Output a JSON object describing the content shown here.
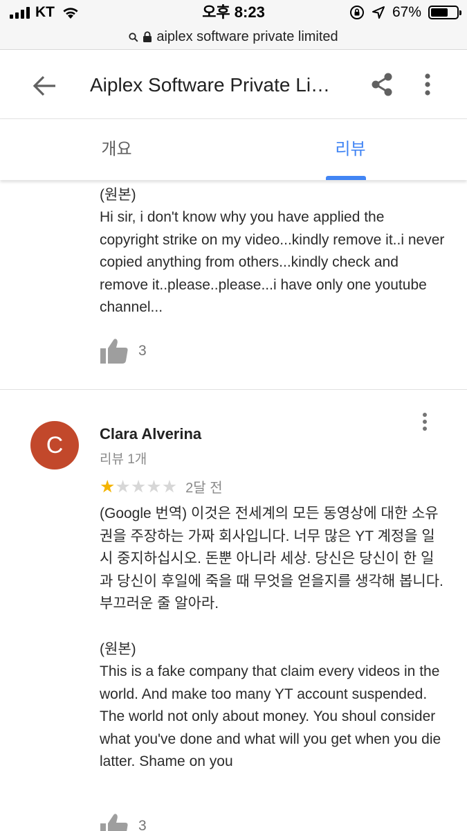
{
  "status_bar": {
    "carrier": "KT",
    "time": "오후 8:23",
    "battery_percent": "67%",
    "battery_level": 0.67
  },
  "url_bar": {
    "text": "aiplex software private limited",
    "icons": [
      "search-icon",
      "lock-icon"
    ]
  },
  "header": {
    "title": "Aiplex Software Private Limited",
    "icons": [
      "back-arrow-icon",
      "share-icon",
      "more-vert-icon"
    ]
  },
  "tabs": [
    {
      "label": "개요",
      "active": false
    },
    {
      "label": "리뷰",
      "active": true
    }
  ],
  "colors": {
    "accent": "#4285f4",
    "avatar_bg": "#c2482b",
    "star_on": "#f4b400",
    "star_off": "#d7d7d7"
  },
  "reviews": [
    {
      "original_label": "(원본)",
      "original_text": "Hi sir, i don't know why you have applied the copyright strike on my video...kindly remove it..i never copied anything from others...kindly check and remove it..please..please...i have only one youtube channel...",
      "likes": "3"
    },
    {
      "avatar_letter": "C",
      "name": "Clara Alverina",
      "review_count": "리뷰 1개",
      "rating": 1,
      "max_rating": 5,
      "date": "2달 전",
      "translated_text": "(Google 번역) 이것은 전세계의 모든 동영상에 대한 소유권을 주장하는 가짜 회사입니다. 너무 많은 YT 계정을 일시 중지하십시오. 돈뿐 아니라 세상. 당신은 당신이 한 일과 당신이 후일에 죽을 때 무엇을 얻을지를 생각해 봅니다. 부끄러운 줄 알아라.",
      "original_label": "(원본)",
      "original_text": "This is a fake company that claim every videos in the world. And make too many YT account suspended. The world not only about money. You shoul consider what you've done and what will you get when you die latter. Shame on you",
      "likes": "3"
    }
  ]
}
